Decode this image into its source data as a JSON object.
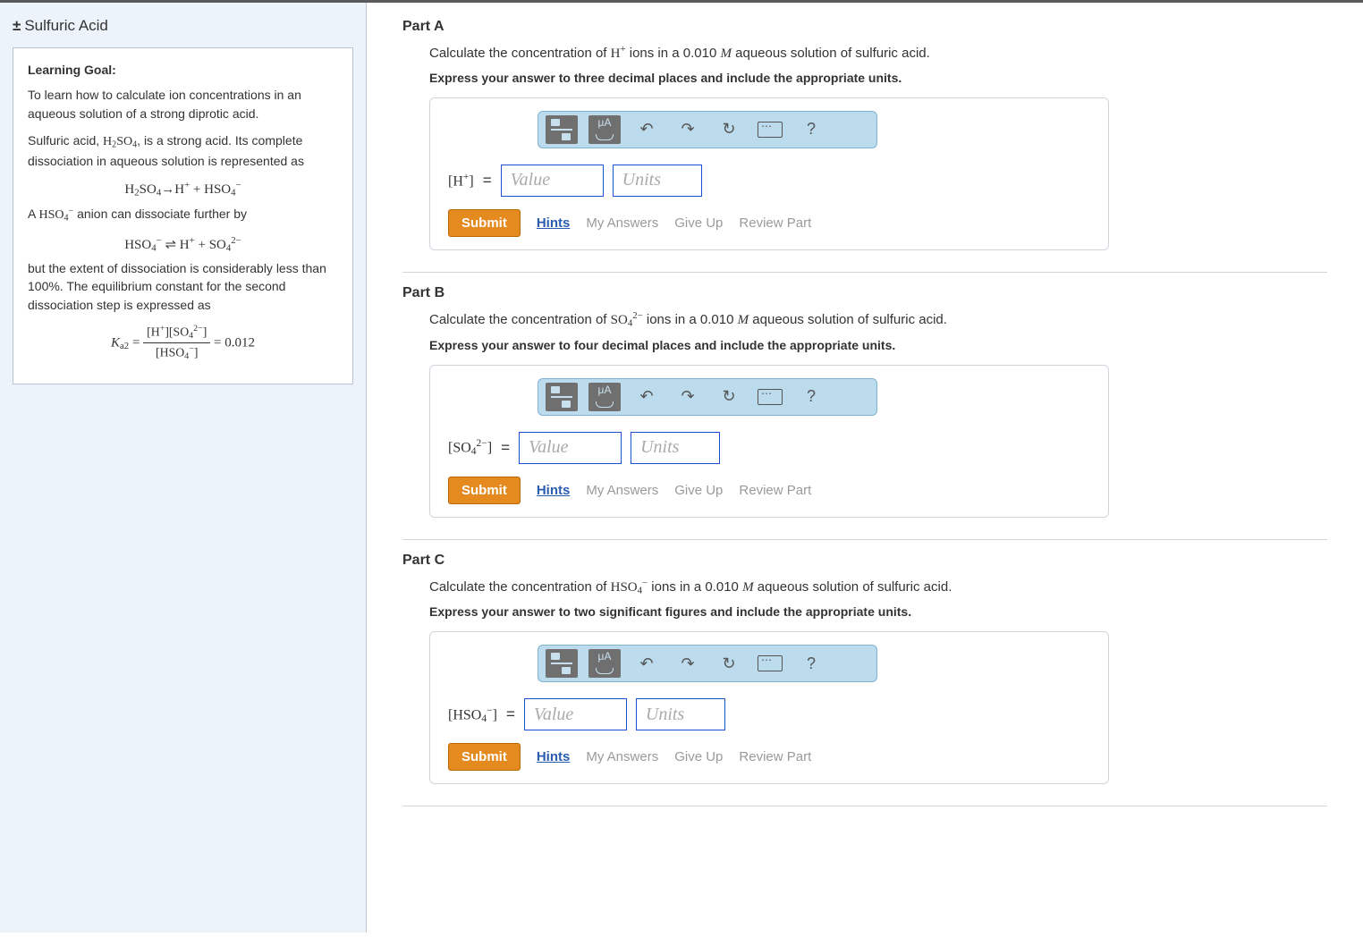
{
  "sidebar": {
    "title_prefix": "±",
    "title": "Sulfuric Acid",
    "heading": "Learning Goal:",
    "para1": "To learn how to calculate ion concentrations in an aqueous solution of a strong diprotic acid.",
    "para2_pre": "Sulfuric acid, ",
    "para2_post": ", is a strong acid. Its complete dissociation in aqueous solution is represented as",
    "para3_pre": "A ",
    "para3_post": " anion can dissociate further by",
    "para4": "but the extent of dissociation is considerably less than 100%. The equilibrium constant for the second dissociation step is expressed as",
    "ka_value": "0.012"
  },
  "common": {
    "value_ph": "Value",
    "units_ph": "Units",
    "submit": "Submit",
    "hints": "Hints",
    "myanswers": "My Answers",
    "giveup": "Give Up",
    "review": "Review Part",
    "mu_label": "μA",
    "help": "?"
  },
  "parts": [
    {
      "title": "Part A",
      "desc_pre": "Calculate the concentration of ",
      "desc_ion_html": "H<sup>+</sup>",
      "desc_mid": " ions in a 0.010 ",
      "desc_unit": "M",
      "desc_post": " aqueous solution of sulfuric acid.",
      "instr": "Express your answer to three decimal places and include the appropriate units.",
      "lhs_html": "[H<sup>+</sup>]"
    },
    {
      "title": "Part B",
      "desc_pre": "Calculate the concentration of ",
      "desc_ion_html": "SO<sub>4</sub><sup>2−</sup>",
      "desc_mid": " ions in a 0.010 ",
      "desc_unit": "M",
      "desc_post": " aqueous solution of sulfuric acid.",
      "instr": "Express your answer to four decimal places and include the appropriate units.",
      "lhs_html": "[SO<sub>4</sub><sup>2−</sup>]"
    },
    {
      "title": "Part C",
      "desc_pre": "Calculate the concentration of ",
      "desc_ion_html": "HSO<sub>4</sub><sup>−</sup>",
      "desc_mid": " ions in a 0.010 ",
      "desc_unit": "M",
      "desc_post": " aqueous solution of sulfuric acid.",
      "instr": "Express your answer to two significant figures and include the appropriate units.",
      "lhs_html": "[HSO<sub>4</sub><sup>−</sup>]"
    }
  ]
}
